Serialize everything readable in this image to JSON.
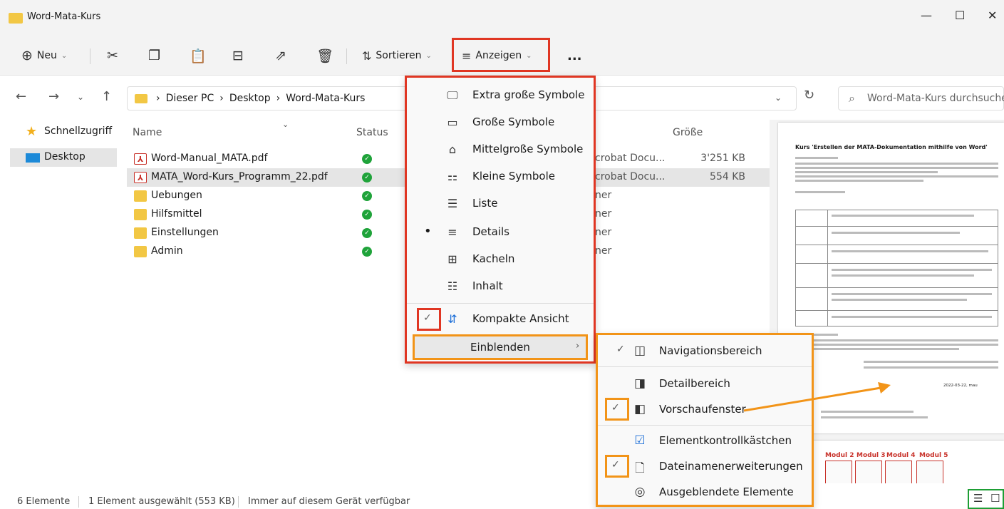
{
  "window": {
    "title": "Word-Mata-Kurs",
    "minimize": "—",
    "maximize": "☐",
    "close": "✕"
  },
  "toolbar": {
    "new_label": "Neu",
    "sort_label": "Sortieren",
    "view_label": "Anzeigen",
    "more_label": "..."
  },
  "address": {
    "crumbs": [
      "Dieser PC",
      "Desktop",
      "Word-Mata-Kurs"
    ],
    "search_placeholder": "Word-Mata-Kurs durchsuchen"
  },
  "sidebar": {
    "items": [
      {
        "label": "Schnellzugriff"
      },
      {
        "label": "Desktop"
      }
    ]
  },
  "columns": {
    "name": "Name",
    "status": "Status",
    "size": "Größe"
  },
  "files": [
    {
      "name": "Word-Manual_MATA.pdf",
      "kind": "pdf",
      "type": "crobat Docu...",
      "size": "3'251 KB"
    },
    {
      "name": "MATA_Word-Kurs_Programm_22.pdf",
      "kind": "pdf",
      "type": "crobat Docu...",
      "size": "554 KB"
    },
    {
      "name": "Uebungen",
      "kind": "folder",
      "type": "ner",
      "size": ""
    },
    {
      "name": "Hilfsmittel",
      "kind": "folder",
      "type": "ner",
      "size": ""
    },
    {
      "name": "Einstellungen",
      "kind": "folder",
      "type": "ner",
      "size": ""
    },
    {
      "name": "Admin",
      "kind": "folder",
      "type": "ner",
      "size": ""
    }
  ],
  "view_menu": {
    "items": [
      {
        "label": "Extra große Symbole"
      },
      {
        "label": "Große Symbole"
      },
      {
        "label": "Mittelgroße Symbole"
      },
      {
        "label": "Kleine Symbole"
      },
      {
        "label": "Liste"
      },
      {
        "label": "Details"
      },
      {
        "label": "Kacheln"
      },
      {
        "label": "Inhalt"
      }
    ],
    "compact_label": "Kompakte Ansicht",
    "show_label": "Einblenden"
  },
  "show_submenu": {
    "items": [
      {
        "label": "Navigationsbereich"
      },
      {
        "label": "Detailbereich"
      },
      {
        "label": "Vorschaufenster"
      },
      {
        "label": "Elementkontrollkästchen"
      },
      {
        "label": "Dateinamenerweiterungen"
      },
      {
        "label": "Ausgeblendete Elemente"
      }
    ]
  },
  "preview": {
    "title": "Kurs  'Erstellen der MATA-Dokumentation mithilfe von Word'",
    "date": "2022-03-22, mau",
    "modules": [
      "Modul 2",
      "Modul 3",
      "Modul 4",
      "Modul 5"
    ]
  },
  "statusbar": {
    "count": "6 Elemente",
    "selected": "1 Element ausgewählt (553 KB)",
    "availability": "Immer auf diesem Gerät verfügbar"
  },
  "colors": {
    "highlight_red": "#e03623",
    "highlight_orange": "#f29418",
    "highlight_green": "#1e9e35",
    "folder": "#f2c744"
  }
}
